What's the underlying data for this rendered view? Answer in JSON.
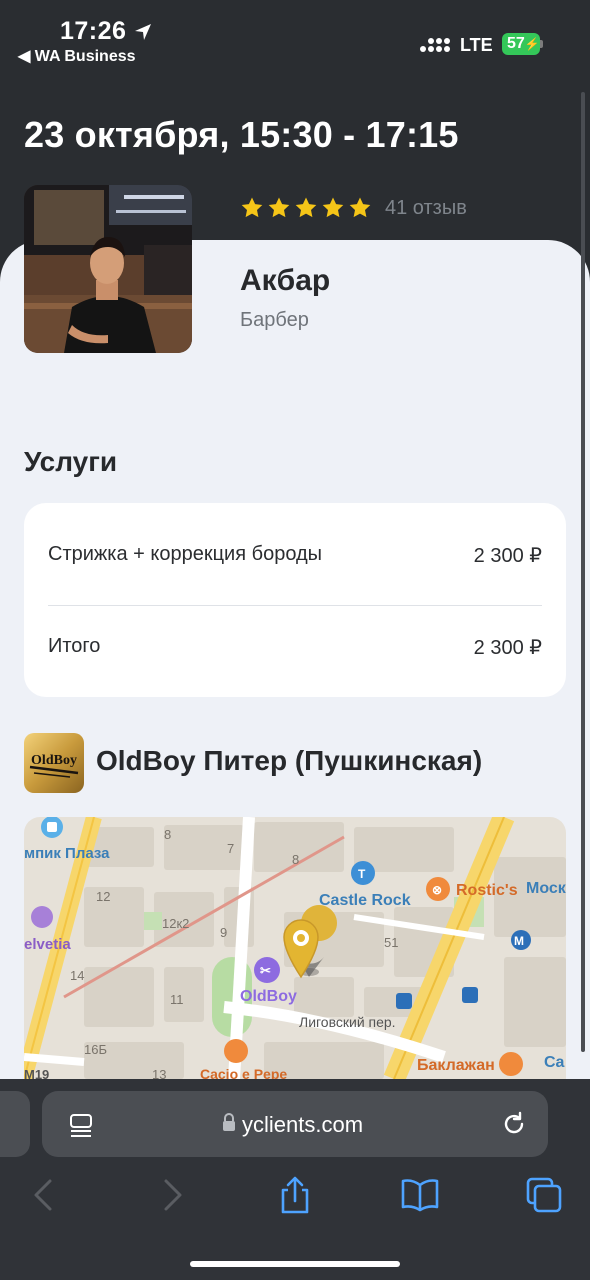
{
  "status_bar": {
    "time": "17:26",
    "back_app": "◀ WA Business",
    "network": "LTE",
    "battery": "57"
  },
  "booking": {
    "datetime": "23 октября, 15:30 - 17:15"
  },
  "master": {
    "rating_stars": 5,
    "reviews": "41 отзыв",
    "name": "Акбар",
    "role": "Барбер"
  },
  "services": {
    "title": "Услуги",
    "items": [
      {
        "name": "Стрижка + коррекция бороды",
        "price": "2 300 ₽"
      }
    ],
    "total_label": "Итого",
    "total_price": "2 300 ₽"
  },
  "salon": {
    "logo_text": "OldBoy",
    "name": "OldBoy Питер (Пушкинская)"
  },
  "map": {
    "labels": {
      "olimpic": "мпик Плаза",
      "castle_rock": "Castle Rock",
      "rostics": "Rostic's",
      "moscow": "Моск",
      "helvetia": "elvetia",
      "oldboy": "OldBoy",
      "ligovsky": "Лиговский пер.",
      "baklazhan": "Баклажан",
      "cacio": "Cacio e Pepe",
      "ca": "Ca",
      "m19": "М19"
    },
    "numbers": [
      "8",
      "7",
      "8",
      "12",
      "12к2",
      "9",
      "51",
      "14",
      "11",
      "16Б",
      "13"
    ]
  },
  "browser": {
    "url": "yclients.com"
  },
  "colors": {
    "accent_star": "#f5c518",
    "battery": "#34c759",
    "background_dark": "#2a2d31",
    "sheet": "#eef1f7"
  }
}
